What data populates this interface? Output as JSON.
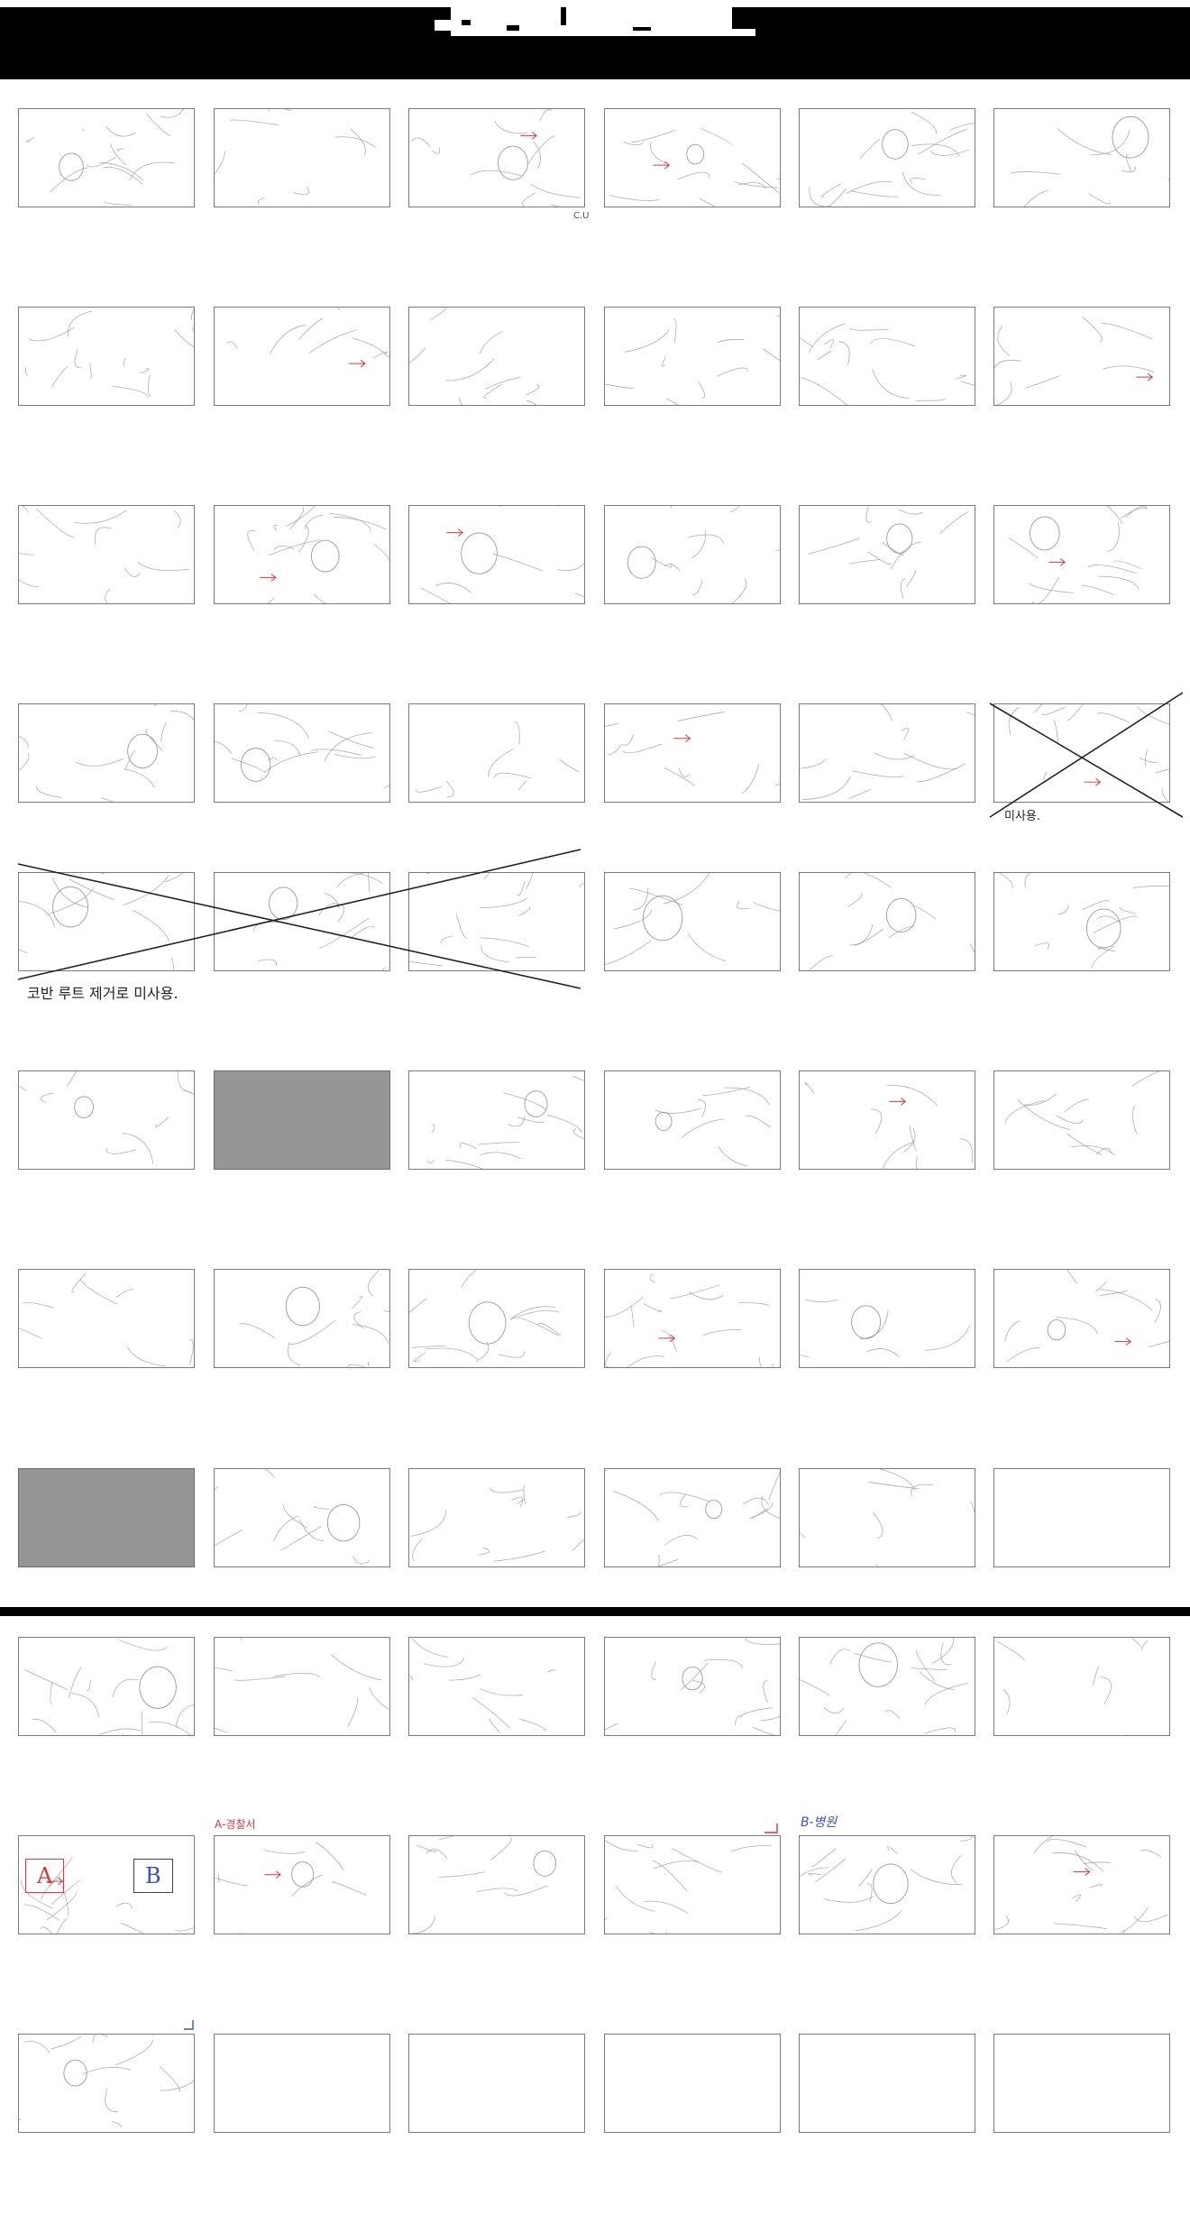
{
  "header": {
    "title": ""
  },
  "panel_grid": {
    "columns": 6,
    "rows": 11,
    "empty_panels_note": "",
    "section_split_after_row": 8
  },
  "panels": {
    "r0": [
      "sketch",
      "sketch",
      "sketch",
      "sketch",
      "sketch",
      "sketch"
    ],
    "r1": [
      "sketch",
      "sketch",
      "sketch",
      "sketch",
      "sketch",
      "sketch"
    ],
    "r2": [
      "sketch",
      "sketch",
      "sketch",
      "sketch",
      "sketch",
      "sketch"
    ],
    "r3": [
      "sketch",
      "sketch",
      "sketch",
      "sketch",
      "sketch",
      "crossed"
    ],
    "r4": [
      "crossed",
      "crossed",
      "crossed",
      "sketch",
      "sketch",
      "sketch"
    ],
    "r5": [
      "sketch",
      "gray",
      "sketch",
      "sketch",
      "sketch",
      "sketch"
    ],
    "r6": [
      "sketch",
      "sketch",
      "sketch",
      "sketch",
      "sketch",
      "sketch"
    ],
    "r7": [
      "gray",
      "sketch",
      "sketch",
      "sketch",
      "sketch",
      "empty"
    ],
    "r8": [
      "sketch",
      "sketch",
      "sketch",
      "sketch",
      "sketch",
      "sketch"
    ],
    "r9": [
      "sketch",
      "sketch",
      "sketch",
      "sketch",
      "sketch",
      "sketch"
    ],
    "r10": [
      "sketch",
      "empty",
      "empty",
      "empty",
      "empty",
      "empty"
    ]
  },
  "annotations": {
    "cu_label": "C.U",
    "unused_label_single": "미사용.",
    "unused_label_group": "코반 루트 제거로 미사용.",
    "panel_letter_a": "A",
    "panel_letter_b": "B",
    "section_a_label": "A-경찰서",
    "section_b_label": "B-병원"
  },
  "colors": {
    "frame_border": "#7a7a7a",
    "gray_panel": "#969696",
    "sketch_stroke": "#9a9a9a",
    "red_mark": "#d9363e",
    "blue_mark": "#3b4fbf",
    "header_bg": "#000000"
  }
}
